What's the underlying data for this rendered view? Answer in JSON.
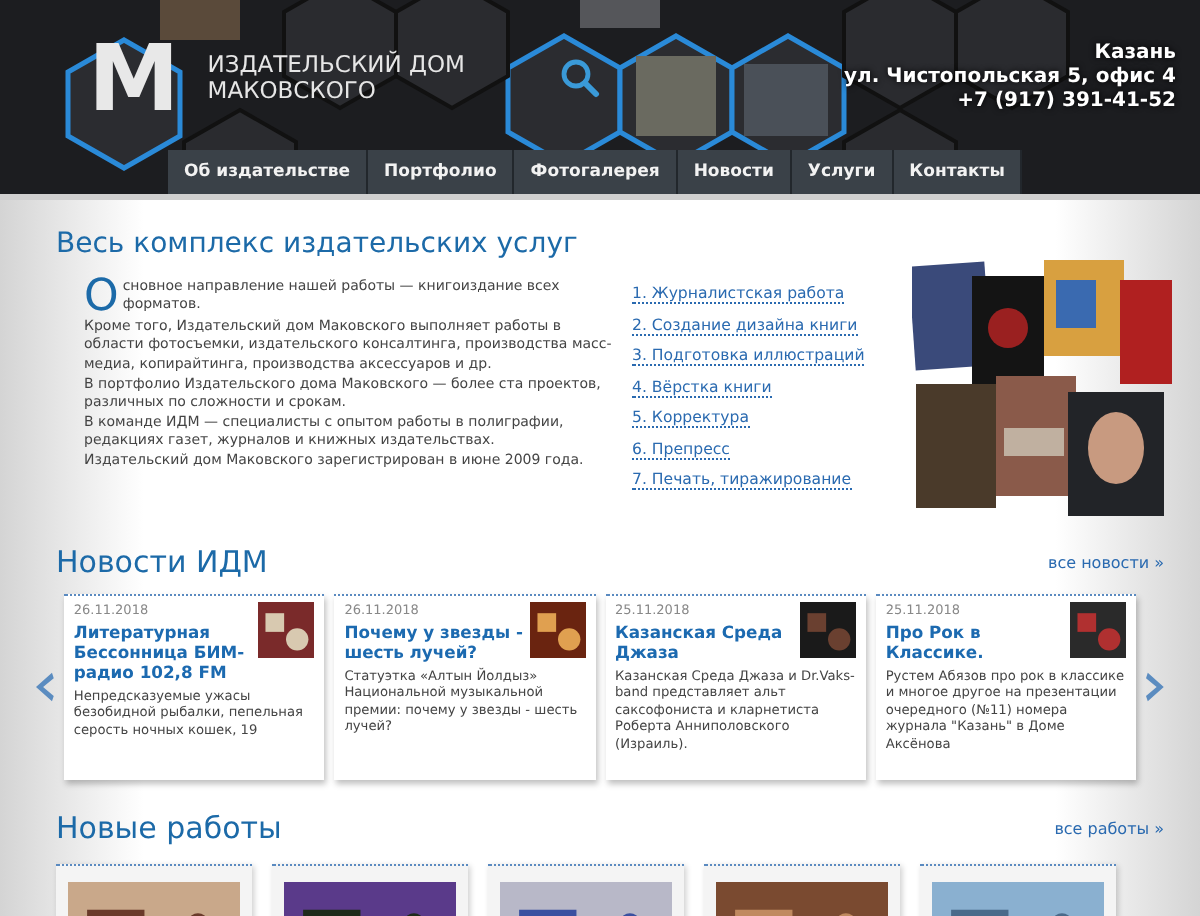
{
  "header": {
    "logo_mark": "M",
    "brand": [
      "ИЗДАТЕЛЬСКИЙ ДОМ",
      "МАКОВСКОГО"
    ],
    "contacts": [
      "Казань",
      "ул. Чистопольская 5, офис 4",
      "+7 (917) 391-41-52"
    ]
  },
  "nav": [
    {
      "label": "Об издательстве",
      "selected": false
    },
    {
      "label": "Портфолио",
      "selected": false
    },
    {
      "label": "Фотогалерея",
      "selected": false
    },
    {
      "label": "Новости",
      "selected": false
    },
    {
      "label": "Услуги",
      "selected": false
    },
    {
      "label": "Контакты",
      "selected": false
    }
  ],
  "intro": {
    "title": "Весь комплекс издательских услуг",
    "initial": "О",
    "paragraphs": [
      "сновное направление нашей работы — книгоиздание всех форматов.",
      "Кроме того, Издательский дом Маковского выполняет работы в области фотосъемки, издательского консалтинга, производства масс-медиа, копирайтинга, производства аксессуаров и др.",
      "В портфолио Издательского дома Маковского — более ста проектов, различных по сложности и срокам.",
      "В команде ИДМ — специалисты с опытом работы в полиграфии, редакциях газет, журналов и книжных издательствах.",
      "Издательский дом Маковского зарегистрирован в июне 2009 года."
    ]
  },
  "services": [
    "1. Журналистская работа",
    "2. Создание дизайна книги",
    "3. Подготовка иллюстраций",
    "4. Вёрстка книги",
    "5. Корректура",
    "6. Препресс",
    "7. Печать, тиражирование"
  ],
  "news": {
    "title": "Новости ИДМ",
    "more": "все новости »",
    "items": [
      {
        "date": "26.11.2018",
        "title": "Литературная Бессонница БИМ-радио 102,8 FM",
        "text": "Непредсказуемые ужасы безобидной рыбалки, пепельная серость ночных кошек, 19"
      },
      {
        "date": "26.11.2018",
        "title": "Почему у звезды - шесть лучей?",
        "text": "Статуэтка «Алтын Йолдыз» Национальной музыкальной премии: почему у звезды - шесть лучей?"
      },
      {
        "date": "25.11.2018",
        "title": "Казанская Среда Джаза",
        "text": "Казанская Среда Джаза и Dr.Vaks-band представляет альт саксофониста и кларнетиста Роберта Анниполовского (Израиль)."
      },
      {
        "date": "25.11.2018",
        "title": "Про Рок в Классике.",
        "text": "Рустем Абязов про рок в классике и многое другое на презентации очередного (№11) номера журнала \"Казань\" в Доме Аксёнова"
      }
    ]
  },
  "works": {
    "title": "Новые работы",
    "more": "все работы »"
  }
}
